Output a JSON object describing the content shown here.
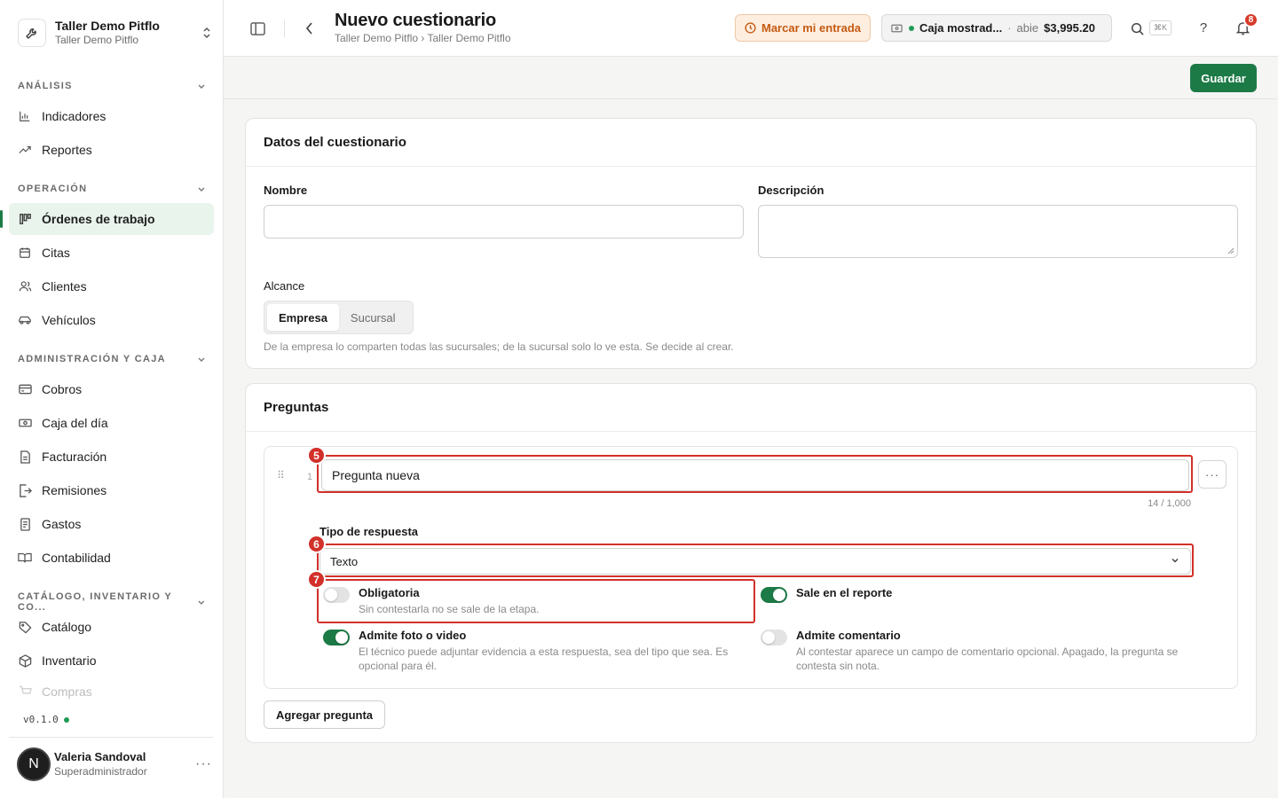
{
  "org": {
    "name": "Taller Demo Pitflo",
    "subtitle": "Taller Demo Pitflo"
  },
  "sidebar": {
    "sections": [
      {
        "title": "ANÁLISIS",
        "items": [
          {
            "label": "Indicadores",
            "icon": "bar-chart-icon"
          },
          {
            "label": "Reportes",
            "icon": "trend-icon"
          }
        ]
      },
      {
        "title": "OPERACIÓN",
        "items": [
          {
            "label": "Órdenes de trabajo",
            "icon": "kanban-icon",
            "active": true
          },
          {
            "label": "Citas",
            "icon": "calendar-icon"
          },
          {
            "label": "Clientes",
            "icon": "users-icon"
          },
          {
            "label": "Vehículos",
            "icon": "car-icon"
          }
        ]
      },
      {
        "title": "ADMINISTRACIÓN Y CAJA",
        "items": [
          {
            "label": "Cobros",
            "icon": "card-icon"
          },
          {
            "label": "Caja del día",
            "icon": "banknote-icon"
          },
          {
            "label": "Facturación",
            "icon": "file-icon"
          },
          {
            "label": "Remisiones",
            "icon": "file-export-icon"
          },
          {
            "label": "Gastos",
            "icon": "receipt-icon"
          },
          {
            "label": "Contabilidad",
            "icon": "book-icon"
          }
        ]
      },
      {
        "title": "CATÁLOGO, INVENTARIO Y CO...",
        "items": [
          {
            "label": "Catálogo",
            "icon": "tag-icon"
          },
          {
            "label": "Inventario",
            "icon": "package-icon"
          },
          {
            "label": "Compras",
            "icon": "cart-icon"
          }
        ]
      }
    ],
    "version": "v0.1.0",
    "user": {
      "initial": "N",
      "name": "Valeria Sandoval",
      "role": "Superadministrador"
    }
  },
  "header": {
    "title": "Nuevo cuestionario",
    "breadcrumb": "Taller Demo Pitflo › Taller Demo Pitflo",
    "clock_in_label": "Marcar mi entrada",
    "cashbox": {
      "name": "Caja mostrad...",
      "separator": "·",
      "status": "abie",
      "amount": "$3,995.20"
    },
    "search_shortcut": "⌘K",
    "notifications_count": "8",
    "help_label": "?"
  },
  "actions": {
    "save_label": "Guardar"
  },
  "details": {
    "heading": "Datos del cuestionario",
    "name_label": "Nombre",
    "name_value": "",
    "description_label": "Descripción",
    "description_value": "",
    "scope_label": "Alcance",
    "scope_options": [
      "Empresa",
      "Sucursal"
    ],
    "scope_selected": "Empresa",
    "scope_hint": "De la empresa lo comparten todas las sucursales; de la sucursal solo lo ve esta. Se decide al crear."
  },
  "questions": {
    "heading": "Preguntas",
    "items": [
      {
        "number": "1",
        "text": "Pregunta nueva",
        "char_counter": "14 / 1,000",
        "answer_type_label": "Tipo de respuesta",
        "answer_type": "Texto",
        "toggles": {
          "required": {
            "title": "Obligatoria",
            "desc": "Sin contestarla no se sale de la etapa.",
            "on": false
          },
          "in_report": {
            "title": "Sale en el reporte",
            "desc": "",
            "on": true
          },
          "media": {
            "title": "Admite foto o video",
            "desc": "El técnico puede adjuntar evidencia a esta respuesta, sea del tipo que sea. Es opcional para él.",
            "on": true
          },
          "comment": {
            "title": "Admite comentario",
            "desc": "Al contestar aparece un campo de comentario opcional. Apagado, la pregunta se contesta sin nota.",
            "on": false
          }
        }
      }
    ],
    "add_label": "Agregar pregunta"
  },
  "annotations": {
    "marker_5": "5",
    "marker_6": "6",
    "marker_7": "7",
    "color": "#d2302a"
  },
  "colors": {
    "brand": "#1c7a46",
    "warning_bg": "#fdeee0",
    "warning_text": "#c55a11",
    "badge": "#d63a2a"
  }
}
